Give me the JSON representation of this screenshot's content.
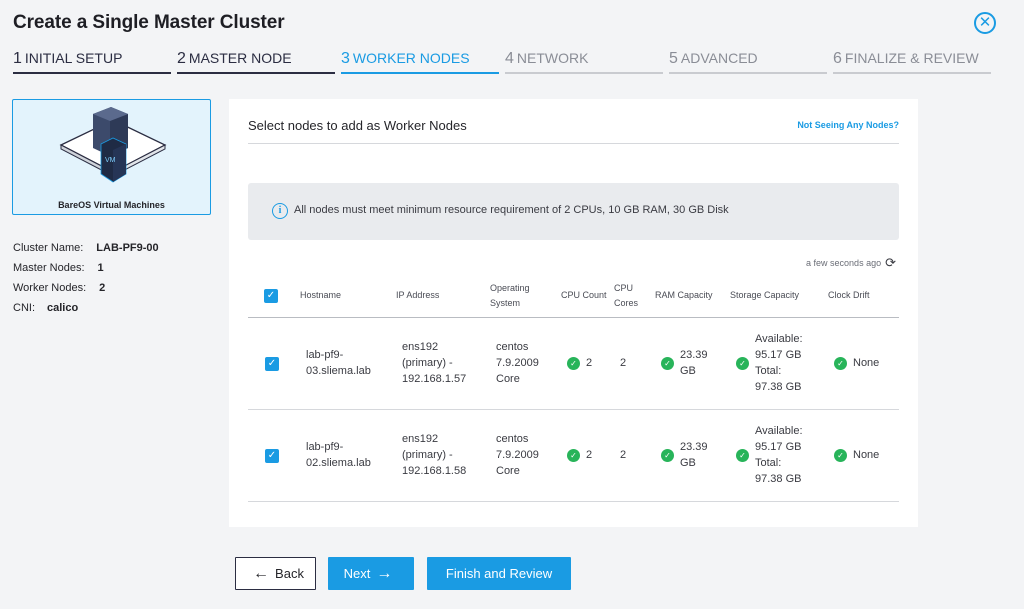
{
  "header": {
    "title": "Create a Single Master Cluster",
    "close_icon": "close-circle-icon"
  },
  "steps": [
    {
      "num": "1",
      "label": "INITIAL SETUP"
    },
    {
      "num": "2",
      "label": "MASTER NODE"
    },
    {
      "num": "3",
      "label": "WORKER NODES"
    },
    {
      "num": "4",
      "label": "NETWORK"
    },
    {
      "num": "5",
      "label": "ADVANCED"
    },
    {
      "num": "6",
      "label": "FINALIZE & REVIEW"
    }
  ],
  "sidebar": {
    "thumb_label": "BareOS Virtual Machines",
    "vm_text": "VM",
    "cluster_name_label": "Cluster Name:",
    "cluster_name": "LAB-PF9-00",
    "master_nodes_label": "Master Nodes:",
    "master_nodes": "1",
    "worker_nodes_label": "Worker Nodes:",
    "worker_nodes": "2",
    "cni_label": "CNI:",
    "cni": "calico"
  },
  "card": {
    "heading": "Select nodes to add as Worker Nodes",
    "help_link": "Not Seeing Any Nodes?",
    "info": "All nodes must meet minimum resource requirement of 2 CPUs, 10 GB RAM, 30 GB Disk",
    "refreshed": "a few seconds ago"
  },
  "table": {
    "columns": {
      "hostname": "Hostname",
      "ip": "IP Address",
      "os": "Operating System",
      "cpu_count": "CPU Count",
      "cpu_cores": "CPU Cores",
      "ram": "RAM Capacity",
      "storage": "Storage Capacity",
      "drift": "Clock Drift"
    },
    "rows": [
      {
        "hostname": "lab-pf9-03.sliema.lab",
        "ip": "ens192 (primary) - 192.168.1.57",
        "os": "centos 7.9.2009 Core",
        "cpu_count": "2",
        "cpu_cores": "2",
        "ram": "23.39 GB",
        "storage": "Available: 95.17 GB Total: 97.38 GB",
        "drift": "None"
      },
      {
        "hostname": "lab-pf9-02.sliema.lab",
        "ip": "ens192 (primary) - 192.168.1.58",
        "os": "centos 7.9.2009 Core",
        "cpu_count": "2",
        "cpu_cores": "2",
        "ram": "23.39 GB",
        "storage": "Available: 95.17 GB Total: 97.38 GB",
        "drift": "None"
      }
    ]
  },
  "footer": {
    "back": "Back",
    "next": "Next",
    "finish": "Finish and Review"
  },
  "colors": {
    "accent": "#1a9be3",
    "success": "#28b45a"
  }
}
